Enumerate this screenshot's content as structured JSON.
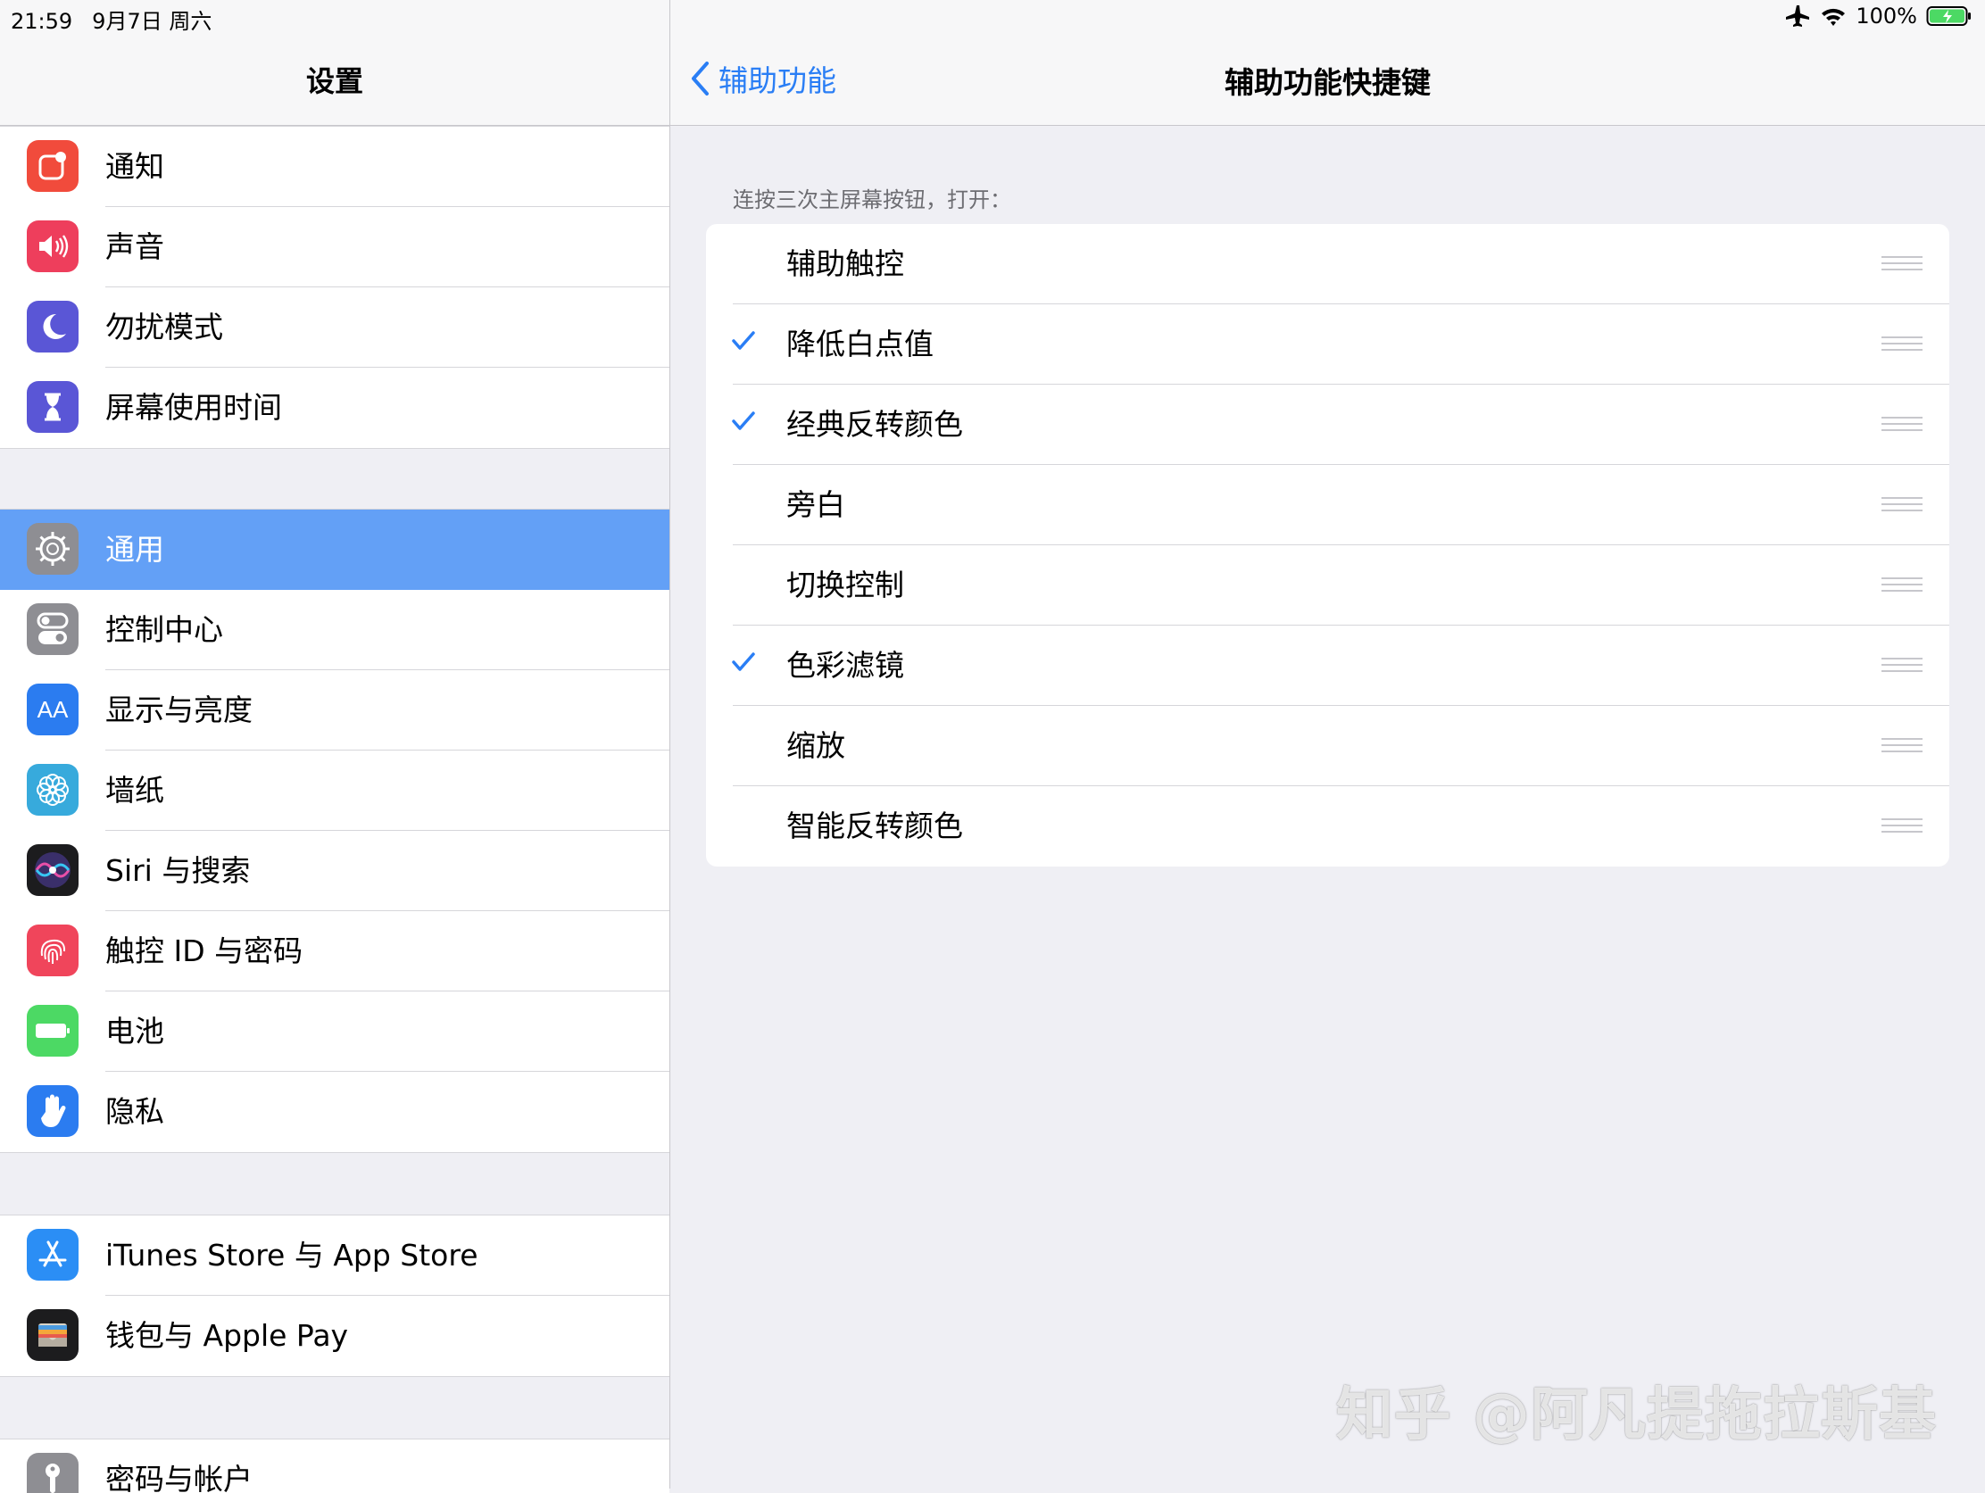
{
  "status_bar": {
    "time": "21:59",
    "date": "9月7日 周六",
    "battery": "100%"
  },
  "left": {
    "title": "设置",
    "groups": [
      [
        {
          "label": "通知",
          "icon": "notifications-icon"
        },
        {
          "label": "声音",
          "icon": "speaker-icon"
        },
        {
          "label": "勿扰模式",
          "icon": "moon-icon"
        },
        {
          "label": "屏幕使用时间",
          "icon": "hourglass-icon"
        }
      ],
      [
        {
          "label": "通用",
          "icon": "gear-icon",
          "selected": true
        },
        {
          "label": "控制中心",
          "icon": "toggles-icon"
        },
        {
          "label": "显示与亮度",
          "icon": "text-size-icon",
          "icon_text": "AA"
        },
        {
          "label": "墙纸",
          "icon": "flower-icon"
        },
        {
          "label": "Siri 与搜索",
          "icon": "siri-icon"
        },
        {
          "label": "触控 ID 与密码",
          "icon": "fingerprint-icon"
        },
        {
          "label": "电池",
          "icon": "battery-icon"
        },
        {
          "label": "隐私",
          "icon": "hand-icon"
        }
      ],
      [
        {
          "label": "iTunes Store 与 App Store",
          "icon": "app-store-icon"
        },
        {
          "label": "钱包与 Apple Pay",
          "icon": "wallet-icon"
        }
      ],
      [
        {
          "label": "密码与帐户",
          "icon": "key-icon"
        }
      ]
    ]
  },
  "right": {
    "back_label": "辅助功能",
    "title": "辅助功能快捷键",
    "section_header": "连按三次主屏幕按钮，打开：",
    "items": [
      {
        "label": "辅助触控",
        "checked": false
      },
      {
        "label": "降低白点值",
        "checked": true
      },
      {
        "label": "经典反转颜色",
        "checked": true
      },
      {
        "label": "旁白",
        "checked": false
      },
      {
        "label": "切换控制",
        "checked": false
      },
      {
        "label": "色彩滤镜",
        "checked": true
      },
      {
        "label": "缩放",
        "checked": false
      },
      {
        "label": "智能反转颜色",
        "checked": false
      }
    ]
  },
  "watermark": "知乎 @阿凡提拖拉斯基",
  "colors": {
    "accent": "#2a7ef5",
    "selected_row": "#63a0f6"
  }
}
